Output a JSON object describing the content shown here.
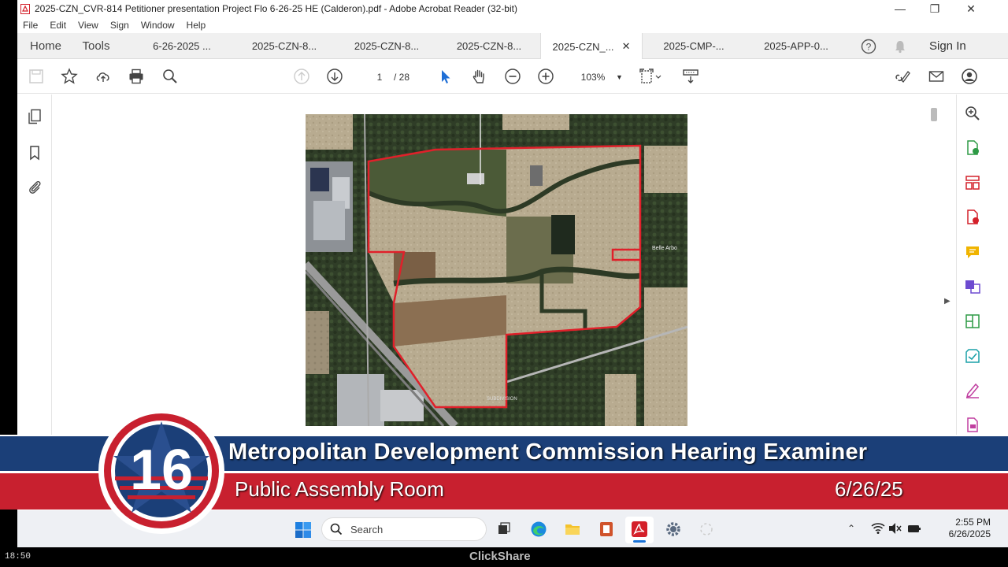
{
  "window": {
    "title": "2025-CZN_CVR-814 Petitioner presentation Project Flo 6-26-25 HE (Calderon).pdf - Adobe Acrobat Reader (32-bit)"
  },
  "menu": [
    "File",
    "Edit",
    "View",
    "Sign",
    "Window",
    "Help"
  ],
  "tabs": {
    "home": "Home",
    "tools": "Tools",
    "documents": [
      {
        "label": "6-26-2025 ...",
        "active": false
      },
      {
        "label": "2025-CZN-8...",
        "active": false
      },
      {
        "label": "2025-CZN-8...",
        "active": false
      },
      {
        "label": "2025-CZN-8...",
        "active": false
      },
      {
        "label": "2025-CZN_...",
        "active": true
      },
      {
        "label": "2025-CMP-...",
        "active": false
      },
      {
        "label": "2025-APP-0...",
        "active": false
      }
    ],
    "sign_in": "Sign In"
  },
  "toolbar": {
    "current_page": "1",
    "total_pages": "/ 28",
    "zoom": "103%"
  },
  "map_labels": {
    "east_label": "Belle Arbo",
    "subdivision": "SUBDIVISION"
  },
  "banner": {
    "title": "Metropolitan Development Commission Hearing Examiner",
    "subtitle": "Public Assembly Room",
    "date": "6/26/25",
    "channel": "16"
  },
  "taskbar": {
    "search_placeholder": "Search",
    "time": "2:55 PM",
    "date": "6/26/2025"
  },
  "footer": {
    "timestamp": "18:50",
    "brand": "ClickShare"
  },
  "colors": {
    "banner_navy": "#1b3f78",
    "banner_red": "#c8202f",
    "boundary": "#e0202a",
    "acrobat_red": "#d4202a"
  }
}
